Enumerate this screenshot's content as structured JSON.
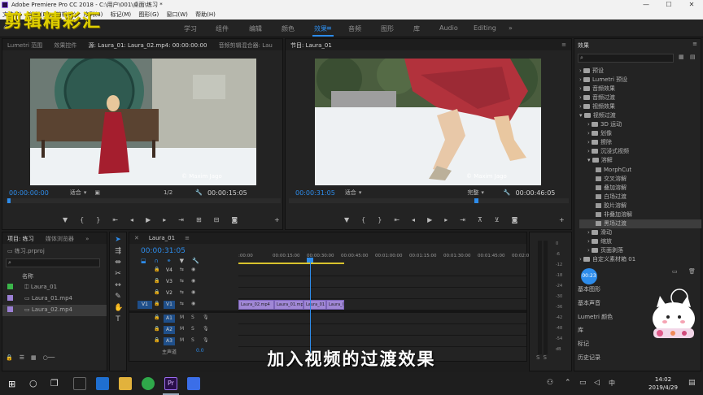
{
  "window": {
    "title": "Adobe Premiere Pro CC 2018 - C:\\用户\\001\\桌面\\练习 *",
    "controls": [
      "—",
      "☐",
      "✕"
    ]
  },
  "menu": [
    "文件(F)",
    "编辑(E)",
    "剪辑(C)",
    "序列(S)",
    "标记(M)",
    "图形(G)",
    "窗口(W)",
    "帮助(H)"
  ],
  "watermark": "剪辑精彩汇",
  "workspaces": [
    "学习",
    "组件",
    "编辑",
    "颜色",
    "效果",
    "音频",
    "图形",
    "库",
    "Audio",
    "Editing"
  ],
  "workspace_active": "效果",
  "source": {
    "tabs": [
      "Lumetri 范围",
      "效果控件",
      "源: Laura_01: Laura_02.mp4: 00:00:00:00",
      "音频剪辑混合器: Lau"
    ],
    "timecode": "00:00:00:00",
    "fit": "适合",
    "ratio": "1/2",
    "duration": "00:00:15:05",
    "video_credit": "© Maxim Jago"
  },
  "program": {
    "tab": "节目: Laura_01",
    "timecode": "00:00:31:05",
    "fit": "适合",
    "quality": "完整",
    "duration": "00:00:46:05",
    "video_credit": "© Maxim Jago"
  },
  "project": {
    "tabs": [
      "项目: 练习",
      "媒体浏览器"
    ],
    "file": "练习.prproj",
    "col_name": "名称",
    "items": [
      {
        "name": "Laura_01",
        "color": "#3bb54a"
      },
      {
        "name": "Laura_01.mp4",
        "color": "#9b7fd4"
      },
      {
        "name": "Laura_02.mp4",
        "color": "#9b7fd4"
      }
    ]
  },
  "timeline": {
    "tab": "Laura_01",
    "timecode": "00:00:31:05",
    "ruler": [
      ":00:00",
      "00:00:15:00",
      "00:00:30:00",
      "00:00:45:00",
      "00:01:00:00",
      "00:01:15:00",
      "00:01:30:00",
      "00:01:45:00",
      "00:02:00"
    ],
    "video_tracks": [
      "V4",
      "V3",
      "V2",
      "V1"
    ],
    "audio_tracks": [
      "A1",
      "A2",
      "A3"
    ],
    "source_patch_v": "V1",
    "master_label": "主声道",
    "master_value": "0.0",
    "clips": [
      "Laura_02.mp4",
      "Laura_01.mp4",
      "Laura_01",
      "Laura_02.mp4"
    ]
  },
  "meter": [
    "0",
    "-6",
    "-12",
    "-18",
    "-24",
    "-30",
    "-36",
    "-42",
    "-48",
    "-54",
    "dB"
  ],
  "effects": {
    "title": "效果",
    "tree": [
      {
        "label": "预设",
        "indent": 0,
        "kind": "folder",
        "open": false
      },
      {
        "label": "Lumetri 预设",
        "indent": 0,
        "kind": "folder",
        "open": false
      },
      {
        "label": "音频效果",
        "indent": 0,
        "kind": "folder",
        "open": false
      },
      {
        "label": "音频过渡",
        "indent": 0,
        "kind": "folder",
        "open": false
      },
      {
        "label": "视频效果",
        "indent": 0,
        "kind": "folder",
        "open": false
      },
      {
        "label": "视频过渡",
        "indent": 0,
        "kind": "folder",
        "open": true
      },
      {
        "label": "3D 运动",
        "indent": 1,
        "kind": "folder",
        "open": false
      },
      {
        "label": "划像",
        "indent": 1,
        "kind": "folder",
        "open": false
      },
      {
        "label": "擦除",
        "indent": 1,
        "kind": "folder",
        "open": false
      },
      {
        "label": "沉浸式视频",
        "indent": 1,
        "kind": "folder",
        "open": false
      },
      {
        "label": "溶解",
        "indent": 1,
        "kind": "folder",
        "open": true
      },
      {
        "label": "MorphCut",
        "indent": 2,
        "kind": "fx",
        "open": false
      },
      {
        "label": "交叉溶解",
        "indent": 2,
        "kind": "fx",
        "open": false
      },
      {
        "label": "叠加溶解",
        "indent": 2,
        "kind": "fx",
        "open": false
      },
      {
        "label": "白场过渡",
        "indent": 2,
        "kind": "fx",
        "open": false
      },
      {
        "label": "胶片溶解",
        "indent": 2,
        "kind": "fx",
        "open": false
      },
      {
        "label": "非叠加溶解",
        "indent": 2,
        "kind": "fx",
        "open": false
      },
      {
        "label": "黑场过渡",
        "indent": 2,
        "kind": "fx",
        "open": false
      },
      {
        "label": "滑动",
        "indent": 1,
        "kind": "folder",
        "open": false
      },
      {
        "label": "缩放",
        "indent": 1,
        "kind": "folder",
        "open": false
      },
      {
        "label": "页面剥落",
        "indent": 1,
        "kind": "folder",
        "open": false
      },
      {
        "label": "自定义素材箱 01",
        "indent": 0,
        "kind": "folder",
        "open": false
      }
    ],
    "selected": "黑场过渡",
    "sections": [
      "基本图形",
      "基本声音",
      "Lumetri 颜色",
      "库",
      "标记",
      "历史记录"
    ]
  },
  "subtitle": "加入视频的过渡效果",
  "taskbar": {
    "time": "14:02",
    "date": "2019/4/29"
  }
}
